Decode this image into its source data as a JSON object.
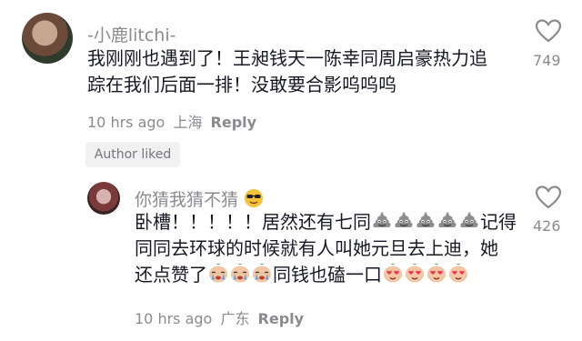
{
  "comments": [
    {
      "username": "-小鹿litchi-",
      "lines": [
        "我刚刚也遇到了！王昶钱天一陈幸同周启豪热力追",
        "踪在我们后面一排！没敢要合影呜呜呜"
      ],
      "time": "10 hrs ago",
      "location": "上海",
      "reply_label": "Reply",
      "likes": "749",
      "badge": "Author liked"
    },
    {
      "username": "你猜我猜不猜",
      "username_emoji": "sunglasses-emoji",
      "line1_text": "卧槽！！！！！居然还有七同",
      "line1_emoji": "poop-emoji",
      "line1_emoji_count": 5,
      "line1_tail": "记得",
      "line2": "同同去环球的时候就有人叫她元旦去上迪，她",
      "line3_text": "还点赞了",
      "line3_emoji_a": "crying-emoji",
      "line3_emoji_a_count": 3,
      "line3_mid": "同钱也磕一口",
      "line3_emoji_b": "heart-eyes-emoji",
      "line3_emoji_b_count": 4,
      "time": "10 hrs ago",
      "location": "广东",
      "reply_label": "Reply",
      "likes": "426"
    }
  ],
  "colors": {
    "text": "#161823",
    "secondary": "#8a8b91",
    "badge_bg": "#f1f1f2"
  }
}
